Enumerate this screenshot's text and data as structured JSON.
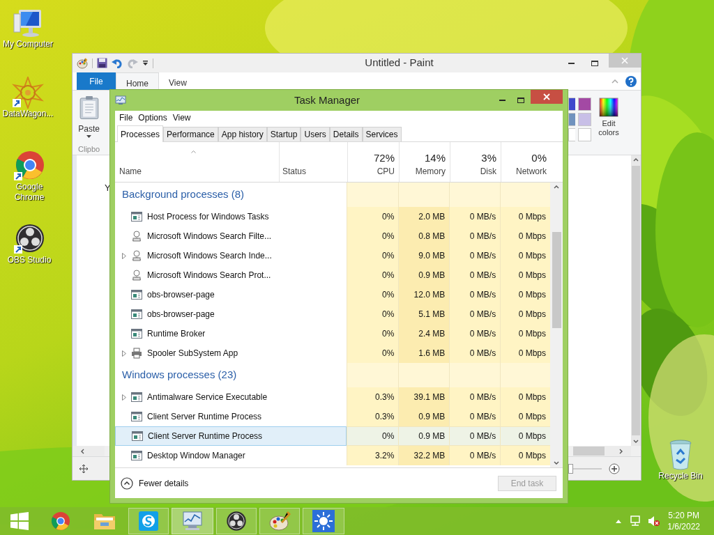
{
  "desktop_icons": [
    {
      "label": "My Computer"
    },
    {
      "label": "DataWagon..."
    },
    {
      "label": "Google Chrome"
    },
    {
      "label": "OBS Studio"
    },
    {
      "label": "Recycle Bin"
    }
  ],
  "paint": {
    "title": "Untitled - Paint",
    "file_button": "File",
    "tabs": [
      {
        "label": "Home",
        "selected": true
      },
      {
        "label": "View",
        "selected": false
      }
    ],
    "paste": "Paste",
    "group_label": "Clipbo",
    "palette": [
      {
        "color": "#3f48cc"
      },
      {
        "color": "#a349a4"
      },
      {
        "color": "#7092be"
      },
      {
        "color": "#c8bfe7"
      },
      {
        "color": "#ffffff"
      },
      {
        "color": "#ffffff"
      }
    ],
    "edit_colors": "Edit colors",
    "canvas_text": "Y",
    "zoom": {
      "level": 0.05
    }
  },
  "task_manager": {
    "title": "Task Manager",
    "menu": [
      "File",
      "Options",
      "View"
    ],
    "tabs": [
      {
        "label": "Processes",
        "selected": true
      },
      {
        "label": "Performance",
        "selected": false
      },
      {
        "label": "App history",
        "selected": false
      },
      {
        "label": "Startup",
        "selected": false
      },
      {
        "label": "Users",
        "selected": false
      },
      {
        "label": "Details",
        "selected": false
      },
      {
        "label": "Services",
        "selected": false
      }
    ],
    "columns": [
      {
        "label": "Name"
      },
      {
        "label": "Status"
      },
      {
        "percent": "72%",
        "label": "CPU"
      },
      {
        "percent": "14%",
        "label": "Memory"
      },
      {
        "percent": "3%",
        "label": "Disk"
      },
      {
        "percent": "0%",
        "label": "Network"
      }
    ],
    "groups": [
      {
        "title": "Background processes (8)",
        "rows": [
          {
            "name": "Host Process for Windows Tasks",
            "kind": "service",
            "expandable": false,
            "selected": false,
            "values": [
              "0%",
              "2.0 MB",
              "0 MB/s",
              "0 Mbps"
            ]
          },
          {
            "name": "Microsoft Windows Search Filte...",
            "kind": "search",
            "expandable": false,
            "selected": false,
            "values": [
              "0%",
              "0.8 MB",
              "0 MB/s",
              "0 Mbps"
            ]
          },
          {
            "name": "Microsoft Windows Search Inde...",
            "kind": "search",
            "expandable": true,
            "selected": false,
            "values": [
              "0%",
              "9.0 MB",
              "0 MB/s",
              "0 Mbps"
            ]
          },
          {
            "name": "Microsoft Windows Search Prot...",
            "kind": "search",
            "expandable": false,
            "selected": false,
            "values": [
              "0%",
              "0.9 MB",
              "0 MB/s",
              "0 Mbps"
            ]
          },
          {
            "name": "obs-browser-page",
            "kind": "service",
            "expandable": false,
            "selected": false,
            "values": [
              "0%",
              "12.0 MB",
              "0 MB/s",
              "0 Mbps"
            ]
          },
          {
            "name": "obs-browser-page",
            "kind": "service",
            "expandable": false,
            "selected": false,
            "values": [
              "0%",
              "5.1 MB",
              "0 MB/s",
              "0 Mbps"
            ]
          },
          {
            "name": "Runtime Broker",
            "kind": "service",
            "expandable": false,
            "selected": false,
            "values": [
              "0%",
              "2.4 MB",
              "0 MB/s",
              "0 Mbps"
            ]
          },
          {
            "name": "Spooler SubSystem App",
            "kind": "printer",
            "expandable": true,
            "selected": false,
            "values": [
              "0%",
              "1.6 MB",
              "0 MB/s",
              "0 Mbps"
            ]
          }
        ]
      },
      {
        "title": "Windows processes (23)",
        "rows": [
          {
            "name": "Antimalware Service Executable",
            "kind": "service",
            "expandable": true,
            "selected": false,
            "values": [
              "0.3%",
              "39.1 MB",
              "0 MB/s",
              "0 Mbps"
            ]
          },
          {
            "name": "Client Server Runtime Process",
            "kind": "service",
            "expandable": false,
            "selected": false,
            "values": [
              "0.3%",
              "0.9 MB",
              "0 MB/s",
              "0 Mbps"
            ]
          },
          {
            "name": "Client Server Runtime Process",
            "kind": "service",
            "expandable": false,
            "selected": true,
            "values": [
              "0%",
              "0.9 MB",
              "0 MB/s",
              "0 Mbps"
            ]
          },
          {
            "name": "Desktop Window Manager",
            "kind": "service",
            "expandable": false,
            "selected": false,
            "values": [
              "3.2%",
              "32.2 MB",
              "0 MB/s",
              "0 Mbps"
            ]
          }
        ]
      }
    ],
    "fewer_details": "Fewer details",
    "end_task": {
      "label": "End task",
      "disabled": true
    }
  },
  "taskbar": {
    "apps": [
      {
        "running": false,
        "selected": false
      },
      {
        "running": false,
        "selected": false
      },
      {
        "running": false,
        "selected": false
      },
      {
        "running": true,
        "selected": false
      },
      {
        "running": true,
        "selected": true
      },
      {
        "running": true,
        "selected": false
      },
      {
        "running": true,
        "selected": false
      },
      {
        "running": true,
        "selected": false
      }
    ],
    "time": "5:20 PM",
    "date": "1/6/2022"
  }
}
